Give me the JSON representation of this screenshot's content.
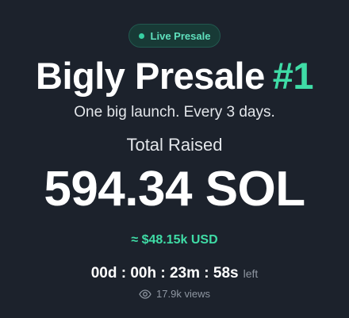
{
  "badge": {
    "label": "Live Presale",
    "icon": "live-dot-icon",
    "color": "#37cfa2"
  },
  "title": {
    "name": "Bigly Presale",
    "number": "#1"
  },
  "tagline": "One big launch. Every 3 days.",
  "raise": {
    "label": "Total Raised",
    "amount": "594.34 SOL",
    "usd": "≈ $48.15k USD"
  },
  "countdown": {
    "time": "00d : 00h : 23m : 58s",
    "suffix": "left"
  },
  "views": {
    "icon": "eye-icon",
    "text": "17.9k views"
  },
  "colors": {
    "background": "#1c222c",
    "accent": "#3fdca6"
  }
}
